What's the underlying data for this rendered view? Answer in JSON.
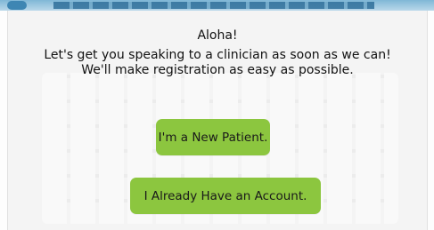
{
  "greeting": "Aloha!",
  "message": {
    "line1": "Let's get you speaking to a clinician as soon as we can!",
    "line2": "We'll make registration as easy as possible."
  },
  "buttons": {
    "new_patient": "I'm a New Patient.",
    "have_account": "I Already Have an Account."
  },
  "colors": {
    "button_green": "#8cc63f",
    "card_background": "#f4f4f4",
    "header_blue": "#3e86b3"
  }
}
